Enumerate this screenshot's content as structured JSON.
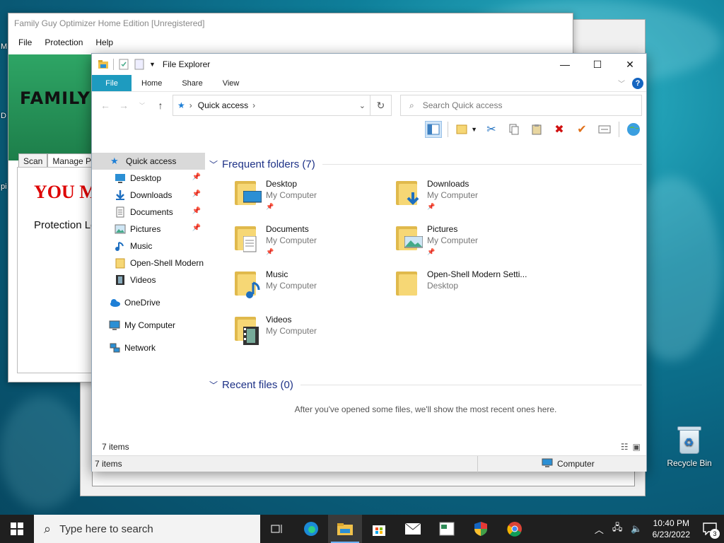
{
  "desktop": {
    "edge_fragments": [
      "M",
      "D",
      "pi"
    ],
    "recycle_bin_label": "Recycle Bin"
  },
  "family_guy": {
    "title": "Family Guy Optimizer Home Edition [Unregistered]",
    "menu": [
      "File",
      "Protection",
      "Help"
    ],
    "banner_text": "FAMILY",
    "tabs": [
      "Scan",
      "Manage Pro"
    ],
    "headline": "YOU M",
    "protection_text": "Protection Le"
  },
  "explorer": {
    "title": "File Explorer",
    "ribbon_tabs": [
      "File",
      "Home",
      "Share",
      "View"
    ],
    "address_location": "Quick access",
    "search_placeholder": "Search Quick access",
    "nav": {
      "quick_access": "Quick access",
      "items": [
        {
          "label": "Desktop",
          "pinned": true,
          "icon": "desktop-icon"
        },
        {
          "label": "Downloads",
          "pinned": true,
          "icon": "downloads-icon"
        },
        {
          "label": "Documents",
          "pinned": true,
          "icon": "documents-icon"
        },
        {
          "label": "Pictures",
          "pinned": true,
          "icon": "pictures-icon"
        },
        {
          "label": "Music",
          "pinned": false,
          "icon": "music-icon"
        },
        {
          "label": "Open-Shell Modern",
          "pinned": false,
          "icon": "folder-icon"
        },
        {
          "label": "Videos",
          "pinned": false,
          "icon": "videos-icon"
        }
      ],
      "onedrive": "OneDrive",
      "my_computer": "My Computer",
      "network": "Network"
    },
    "frequent_header": "Frequent folders (7)",
    "folders": [
      {
        "name": "Desktop",
        "location": "My Computer",
        "pinned": true,
        "icon": "desktop-folder-icon"
      },
      {
        "name": "Downloads",
        "location": "My Computer",
        "pinned": true,
        "icon": "downloads-folder-icon"
      },
      {
        "name": "Documents",
        "location": "My Computer",
        "pinned": true,
        "icon": "documents-folder-icon"
      },
      {
        "name": "Pictures",
        "location": "My Computer",
        "pinned": true,
        "icon": "pictures-folder-icon"
      },
      {
        "name": "Music",
        "location": "My Computer",
        "pinned": false,
        "icon": "music-folder-icon"
      },
      {
        "name": "Open-Shell Modern Setti...",
        "location": "Desktop",
        "pinned": false,
        "icon": "folder-icon"
      },
      {
        "name": "Videos",
        "location": "My Computer",
        "pinned": false,
        "icon": "videos-folder-icon"
      }
    ],
    "recent_header": "Recent files (0)",
    "recent_empty": "After you've opened some files, we'll show the most recent ones here.",
    "status_items": "7 items",
    "status_bar_items": "7 items",
    "status_bar_location": "Computer"
  },
  "taskbar": {
    "search_placeholder": "Type here to search",
    "time": "10:40 PM",
    "date": "6/23/2022",
    "notification_count": "3"
  }
}
